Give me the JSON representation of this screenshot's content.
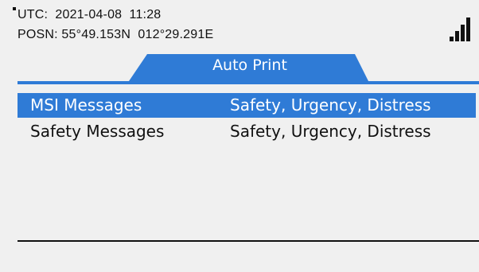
{
  "status": {
    "utc_line": "UTC:  2021-04-08  11:28",
    "posn_line": "POSN: 55°49.153N  012°29.291E",
    "signal_icon": "signal-strength-icon",
    "signal_level": 1.0
  },
  "tab": {
    "label": "Auto Print",
    "color": "#2f7bd6"
  },
  "messages": [
    {
      "name": "MSI Messages",
      "value": "Safety, Urgency, Distress",
      "selected": true
    },
    {
      "name": "Safety Messages",
      "value": "Safety, Urgency, Distress",
      "selected": false
    }
  ],
  "colors": {
    "accent": "#2f7bd6",
    "background": "#f0f0f0",
    "text": "#111111"
  }
}
